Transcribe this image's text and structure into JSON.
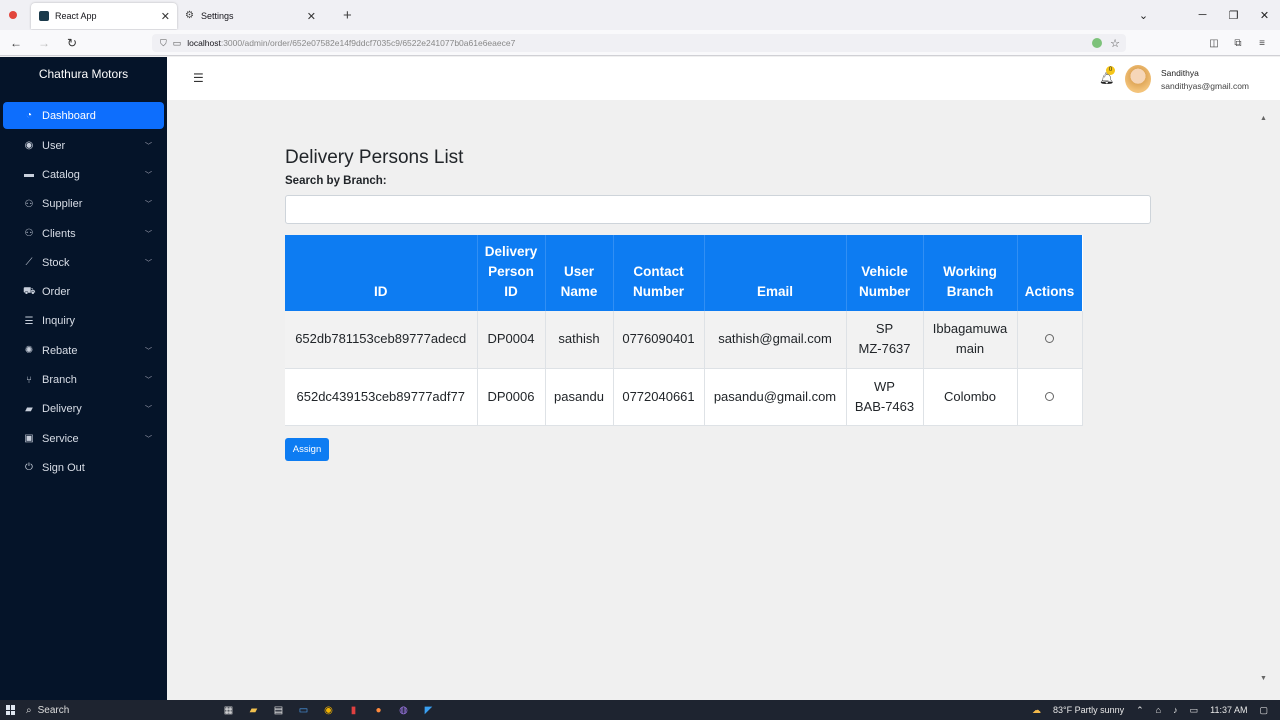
{
  "browser": {
    "tabs": [
      {
        "label": "React App",
        "active": true
      },
      {
        "label": "Settings",
        "active": false
      }
    ],
    "url_host": "localhost",
    "url_path": ":3000/admin/order/652e07582e14f9ddcf7035c9/6522e241077b0a61e6eaece7"
  },
  "sidebar": {
    "brand": "Chathura Motors",
    "items": [
      {
        "label": "Dashboard",
        "icon": "dashboard-icon",
        "active": true,
        "chevron": false
      },
      {
        "label": "User",
        "icon": "user-circle-icon",
        "chevron": true
      },
      {
        "label": "Catalog",
        "icon": "box-icon",
        "chevron": true
      },
      {
        "label": "Supplier",
        "icon": "people-icon",
        "chevron": true
      },
      {
        "label": "Clients",
        "icon": "people-icon",
        "chevron": true
      },
      {
        "label": "Stock",
        "icon": "chart-line-icon",
        "chevron": true
      },
      {
        "label": "Order",
        "icon": "cart-icon",
        "chevron": false
      },
      {
        "label": "Inquiry",
        "icon": "list-icon",
        "chevron": false
      },
      {
        "label": "Rebate",
        "icon": "gear-badge-icon",
        "chevron": true
      },
      {
        "label": "Branch",
        "icon": "branch-icon",
        "chevron": true
      },
      {
        "label": "Delivery",
        "icon": "truck-icon",
        "chevron": true
      },
      {
        "label": "Service",
        "icon": "briefcase-icon",
        "chevron": true
      },
      {
        "label": "Sign Out",
        "icon": "signout-icon",
        "chevron": false
      }
    ]
  },
  "header": {
    "user_name": "Sandithya",
    "user_email": "sandithyas@gmail.com",
    "notification_count": "0"
  },
  "main": {
    "title": "Delivery Persons List",
    "search_label": "Search by Branch:",
    "search_value": "",
    "columns": [
      [
        "ID"
      ],
      [
        "Delivery",
        "Person",
        "ID"
      ],
      [
        "User",
        "Name"
      ],
      [
        "Contact",
        "Number"
      ],
      [
        "Email"
      ],
      [
        "Vehicle",
        "Number"
      ],
      [
        "Working",
        "Branch"
      ],
      [
        "Actions"
      ]
    ],
    "rows": [
      {
        "id": "652db781153ceb89777adecd",
        "person_id": "DP0004",
        "user_name": "sathish",
        "contact": "0776090401",
        "email": "sathish@gmail.com",
        "vehicle": [
          "SP",
          "MZ-7637"
        ],
        "branch": [
          "Ibbagamuwa",
          "main"
        ]
      },
      {
        "id": "652dc439153ceb89777adf77",
        "person_id": "DP0006",
        "user_name": "pasandu",
        "contact": "0772040661",
        "email": "pasandu@gmail.com",
        "vehicle": [
          "WP",
          "BAB-7463"
        ],
        "branch": [
          "Colombo"
        ]
      }
    ],
    "assign_label": "Assign"
  },
  "taskbar": {
    "search_label": "Search",
    "weather": "83°F  Partly sunny",
    "time": "11:37 AM"
  },
  "colors": {
    "sidebar_bg": "#051429",
    "accent": "#0d6efd",
    "table_header": "#0d7cf2"
  }
}
